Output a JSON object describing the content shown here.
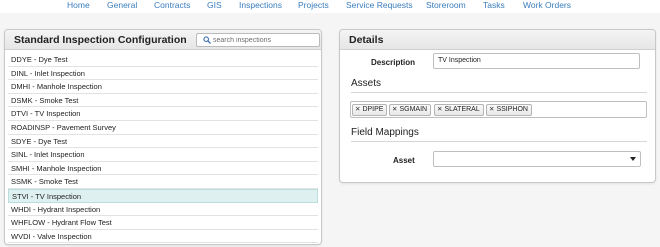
{
  "nav": {
    "items": [
      "Home",
      "General",
      "Contracts",
      "GIS",
      "Inspections",
      "Projects",
      "Service Requests",
      "Storeroom",
      "Tasks",
      "Work Orders"
    ]
  },
  "left_panel": {
    "title": "Standard Inspection Configuration",
    "search_placeholder": "search inspections",
    "items": [
      "DDYE - Dye Test",
      "DINL - Inlet Inspection",
      "DMHI - Manhole Inspection",
      "DSMK - Smoke Test",
      "DTVI - TV Inspection",
      "ROADINSP - Pavement Survey",
      "SDYE - Dye Test",
      "SINL - Inlet Inspection",
      "SMHI - Manhole Inspection",
      "SSMK - Smoke Test",
      "STVI - TV Inspection",
      "WHDI - Hydrant Inspection",
      "WHFLOW - Hydrant Flow Test",
      "WVDI - Valve Inspection"
    ],
    "selected_item": "STVI - TV Inspection"
  },
  "details": {
    "title": "Details",
    "description_label": "Description",
    "description_value": "TV Inspection",
    "assets_title": "Assets",
    "assets": [
      "DPIPE",
      "SGMAIN",
      "SLATERAL",
      "SSIPHON"
    ],
    "field_mappings_title": "Field Mappings",
    "asset_label": "Asset",
    "asset_value": ""
  },
  "colors": {
    "nav_link": "#3a7dbd",
    "selected_row": "#dff0f0",
    "page_background": "#f5f5f5"
  },
  "icons": {
    "search": "search-icon",
    "tag_remove": "close-icon",
    "select_caret": "caret-down-icon"
  }
}
